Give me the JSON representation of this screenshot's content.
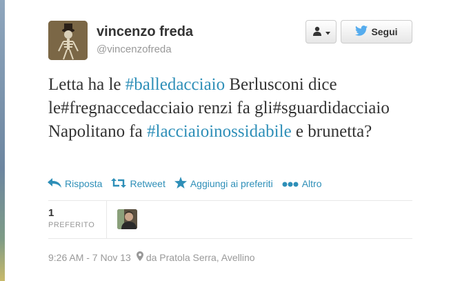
{
  "user": {
    "name": "vincenzo freda",
    "handle": "@vincenzofreda"
  },
  "header_buttons": {
    "user_menu_icon": "user-dropdown-icon",
    "follow_label": "Segui",
    "follow_icon": "twitter-bird-icon"
  },
  "tweet": {
    "segments": [
      {
        "text": "Letta ha le ",
        "hashtag": false
      },
      {
        "text": "#balledacciaio",
        "hashtag": true
      },
      {
        "text": " Berlusconi dice le#fregnaccedacciaio renzi fa gli#sguardidacciaio Napolitano fa ",
        "hashtag": false
      },
      {
        "text": "#lacciaioinossidabile",
        "hashtag": true
      },
      {
        "text": " e brunetta?",
        "hashtag": false
      }
    ]
  },
  "actions": [
    {
      "label": "Risposta",
      "icon": "reply-icon"
    },
    {
      "label": "Retweet",
      "icon": "retweet-icon"
    },
    {
      "label": "Aggiungi ai preferiti",
      "icon": "star-icon"
    },
    {
      "label": "Altro",
      "icon": "more-dots-icon"
    }
  ],
  "stats": {
    "favorites_count": "1",
    "favorites_label": "PREFERITO"
  },
  "meta": {
    "timestamp": "9:26 AM - 7 Nov 13",
    "location": "da Pratola Serra, Avellino",
    "location_icon": "map-pin-icon"
  },
  "colors": {
    "link": "#2e8fb8",
    "text": "#333333",
    "muted": "#999999",
    "twitter_blue": "#55acee"
  }
}
